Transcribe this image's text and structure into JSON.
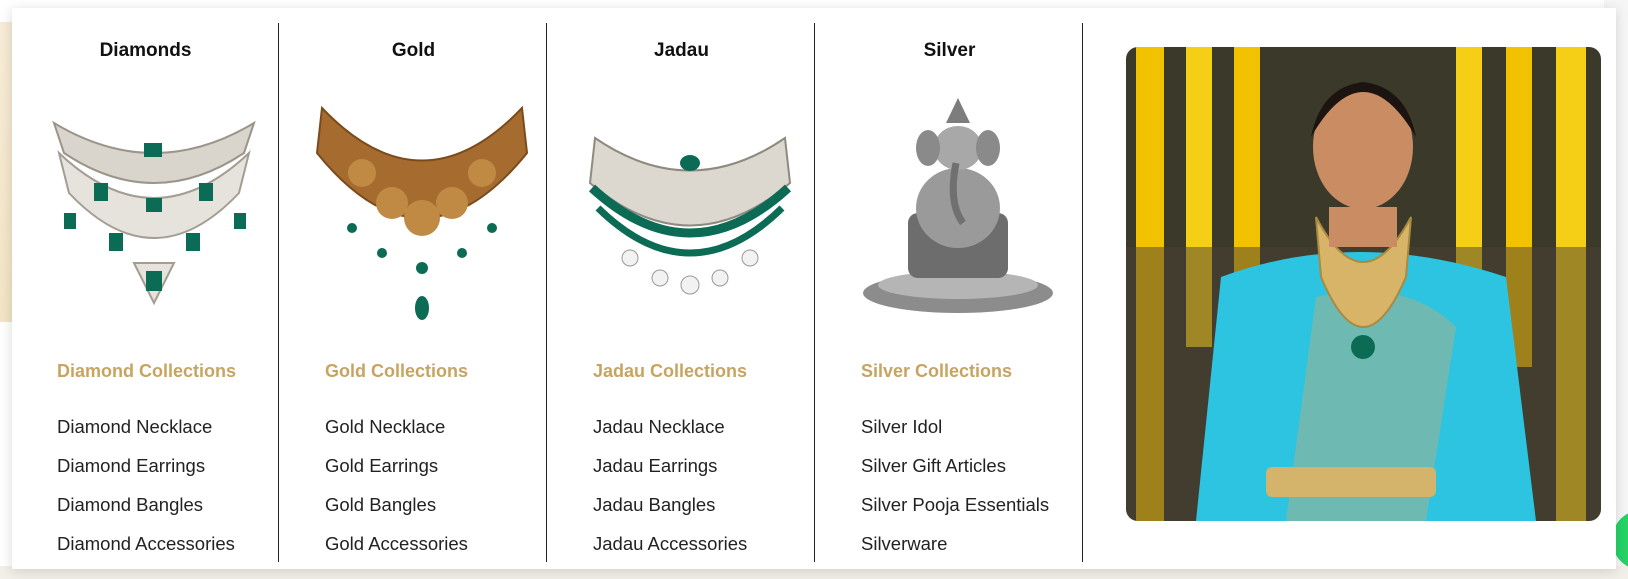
{
  "menu": {
    "columns": [
      {
        "title": "Diamonds",
        "image_icon": "diamond-necklace-image",
        "collection_label": "Diamond Collections",
        "items": [
          "Diamond Necklace",
          "Diamond Earrings",
          "Diamond Bangles",
          "Diamond Accessories"
        ]
      },
      {
        "title": "Gold",
        "image_icon": "gold-necklace-image",
        "collection_label": "Gold Collections",
        "items": [
          "Gold Necklace",
          "Gold Earrings",
          "Gold Bangles",
          "Gold Accessories"
        ]
      },
      {
        "title": "Jadau",
        "image_icon": "jadau-necklace-image",
        "collection_label": "Jadau Collections",
        "items": [
          "Jadau Necklace",
          "Jadau Earrings",
          "Jadau Bangles",
          "Jadau Accessories"
        ]
      },
      {
        "title": "Silver",
        "image_icon": "silver-idol-image",
        "collection_label": "Silver Collections",
        "items": [
          "Silver Idol",
          "Silver Gift Articles",
          "Silver Pooja Essentials",
          "Silverware"
        ]
      }
    ],
    "hero_image": "bride-jewellery-model-image"
  },
  "colors": {
    "accent_gold": "#c8a462",
    "text_dark": "#222222",
    "divider": "#222222"
  }
}
